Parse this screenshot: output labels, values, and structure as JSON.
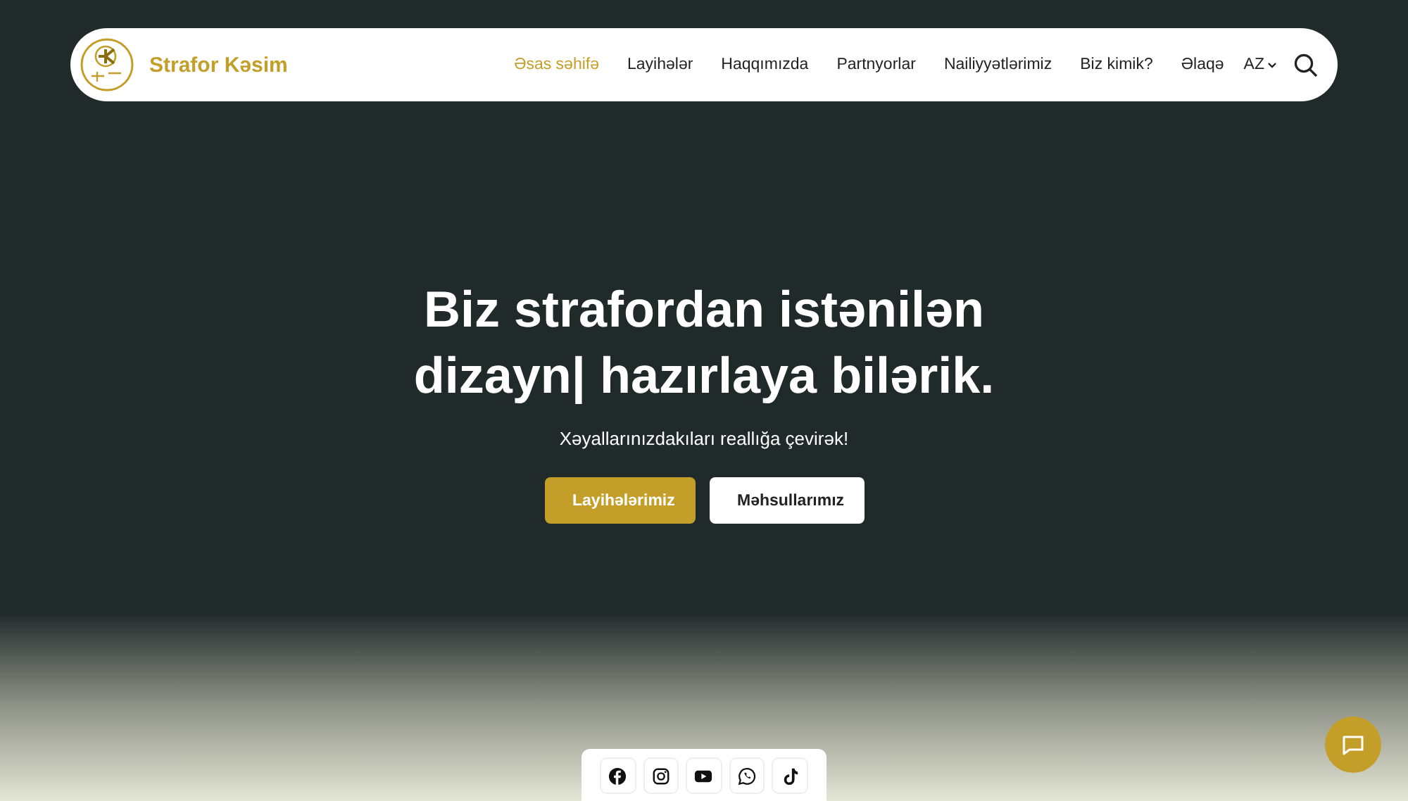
{
  "header": {
    "brand": "Strafor Kəsim",
    "nav": [
      {
        "label": "Əsas səhifə",
        "selected": true
      },
      {
        "label": "Layihələr",
        "selected": false
      },
      {
        "label": "Haqqımızda",
        "selected": false
      },
      {
        "label": "Partnyorlar",
        "selected": false
      },
      {
        "label": "Nailiyyətlərimiz",
        "selected": false
      },
      {
        "label": "Biz kimik?",
        "selected": false
      },
      {
        "label": "Əlaqə",
        "selected": false
      }
    ],
    "language": "AZ"
  },
  "hero": {
    "title": "Biz strafordan istənilən dizayn| hazırlaya bilərik.",
    "subtitle": "Xəyallarınızdakıları reallığa çevirək!",
    "buttons": [
      {
        "label": "Layihələrimiz",
        "kind": "primary"
      },
      {
        "label": "Məhsullarımız",
        "kind": "secondary"
      }
    ]
  },
  "social": [
    {
      "kind": "facebook"
    },
    {
      "kind": "instagram"
    },
    {
      "kind": "youtube"
    },
    {
      "kind": "whatsapp"
    },
    {
      "kind": "tiktok"
    }
  ]
}
